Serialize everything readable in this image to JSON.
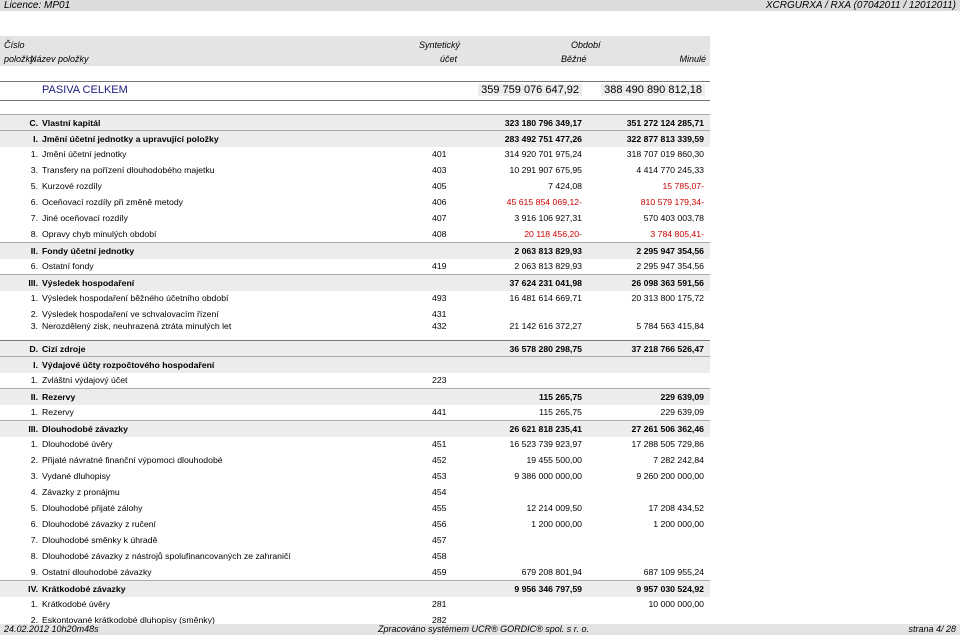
{
  "top": {
    "left": "Licence: MP01",
    "right": "XCRGURXA / RXA  (07042011 / 12012011)"
  },
  "header": {
    "cislo": "Číslo",
    "polozky": "položky",
    "nazev": "Název položky",
    "synteticky": "Syntetický",
    "ucet": "účet",
    "obdobi": "Období",
    "bezne": "Běžné",
    "minule": "Minulé"
  },
  "pasiva": {
    "label": "PASIVA CELKEM",
    "bezne": "359 759 076 647,92",
    "minule": "388 490 890 812,18"
  },
  "rows": [
    {
      "c": "C.",
      "n": "Vlastní kapitál",
      "a": "",
      "v1": "323 180 796 349,17",
      "v2": "351 272 124 285,71"
    },
    {
      "c": "I.",
      "n": "Jmění účetní jednotky a upravující položky",
      "a": "",
      "v1": "283 492 751 477,26",
      "v2": "322 877 813 339,59"
    },
    {
      "c": "1.",
      "n": "Jmění účetní jednotky",
      "a": "401",
      "v1": "314 920 701 975,24",
      "v2": "318 707 019 860,30"
    },
    {
      "c": "3.",
      "n": "Transfery na pořízení dlouhodobého majetku",
      "a": "403",
      "v1": "10 291 907 675,95",
      "v2": "4 414 770 245,33"
    },
    {
      "c": "5.",
      "n": "Kurzové rozdíly",
      "a": "405",
      "v1": "7 424,08",
      "v2": "15 785,07-"
    },
    {
      "c": "6.",
      "n": "Oceňovací rozdíly při změně metody",
      "a": "406",
      "v1": "45 615 854 069,12-",
      "v2": "810 579 179,34-"
    },
    {
      "c": "7.",
      "n": "Jiné oceňovací rozdíly",
      "a": "407",
      "v1": "3 916 106 927,31",
      "v2": "570 403 003,78"
    },
    {
      "c": "8.",
      "n": "Opravy chyb minulých období",
      "a": "408",
      "v1": "20 118 456,20-",
      "v2": "3 784 805,41-"
    },
    {
      "c": "II.",
      "n": "Fondy účetní jednotky",
      "a": "",
      "v1": "2 063 813 829,93",
      "v2": "2 295 947 354,56"
    },
    {
      "c": "6.",
      "n": "Ostatní fondy",
      "a": "419",
      "v1": "2 063 813 829,93",
      "v2": "2 295 947 354,56"
    },
    {
      "c": "III.",
      "n": "Výsledek hospodaření",
      "a": "",
      "v1": "37 624 231 041,98",
      "v2": "26 098 363 591,56"
    },
    {
      "c": "1.",
      "n": "Výsledek hospodaření běžného účetního období",
      "a": "493",
      "v1": "16 481 614 669,71",
      "v2": "20 313 800 175,72"
    },
    {
      "c": "2.",
      "n": "Výsledek hospodaření ve schvalovacím řízení",
      "a": "431",
      "v1": "",
      "v2": ""
    },
    {
      "c": "3.",
      "n": "Nerozdělený zisk, neuhrazená ztráta minulých let",
      "a": "432",
      "v1": "21 142 616 372,27",
      "v2": "5 784 563 415,84"
    },
    {
      "c": "D.",
      "n": "Cizí zdroje",
      "a": "",
      "v1": "36 578 280 298,75",
      "v2": "37 218 766 526,47"
    },
    {
      "c": "I.",
      "n": "Výdajové účty rozpočtového hospodaření",
      "a": "",
      "v1": "",
      "v2": ""
    },
    {
      "c": "1.",
      "n": "Zvláštní výdajový účet",
      "a": "223",
      "v1": "",
      "v2": ""
    },
    {
      "c": "II.",
      "n": "Rezervy",
      "a": "",
      "v1": "115 265,75",
      "v2": "229 639,09"
    },
    {
      "c": "1.",
      "n": "Rezervy",
      "a": "441",
      "v1": "115 265,75",
      "v2": "229 639,09"
    },
    {
      "c": "III.",
      "n": "Dlouhodobé závazky",
      "a": "",
      "v1": "26 621 818 235,41",
      "v2": "27 261 506 362,46"
    },
    {
      "c": "1.",
      "n": "Dlouhodobé úvěry",
      "a": "451",
      "v1": "16 523 739 923,97",
      "v2": "17 288 505 729,86"
    },
    {
      "c": "2.",
      "n": "Přijaté návratné finanční výpomoci dlouhodobé",
      "a": "452",
      "v1": "19 455 500,00",
      "v2": "7 282 242,84"
    },
    {
      "c": "3.",
      "n": "Vydané dluhopisy",
      "a": "453",
      "v1": "9 386 000 000,00",
      "v2": "9 260 200 000,00"
    },
    {
      "c": "4.",
      "n": "Závazky z pronájmu",
      "a": "454",
      "v1": "",
      "v2": ""
    },
    {
      "c": "5.",
      "n": "Dlouhodobé přijaté zálohy",
      "a": "455",
      "v1": "12 214 009,50",
      "v2": "17 208 434,52"
    },
    {
      "c": "6.",
      "n": "Dlouhodobé závazky z ručení",
      "a": "456",
      "v1": "1 200 000,00",
      "v2": "1 200 000,00"
    },
    {
      "c": "7.",
      "n": "Dlouhodobé směnky k úhradě",
      "a": "457",
      "v1": "",
      "v2": ""
    },
    {
      "c": "8.",
      "n": "Dlouhodobé závazky z nástrojů spolufinancovaných ze zahraničí",
      "a": "458",
      "v1": "",
      "v2": ""
    },
    {
      "c": "9.",
      "n": "Ostatní dlouhodobé závazky",
      "a": "459",
      "v1": "679 208 801,94",
      "v2": "687 109 955,24"
    },
    {
      "c": "IV.",
      "n": "Krátkodobé závazky",
      "a": "",
      "v1": "9 956 346 797,59",
      "v2": "9 957 030 524,92"
    },
    {
      "c": "1.",
      "n": "Krátkodobé úvěry",
      "a": "281",
      "v1": "",
      "v2": "10 000 000,00"
    },
    {
      "c": "2.",
      "n": "Eskontované krátkodobé dluhopisy (směnky)",
      "a": "282",
      "v1": "",
      "v2": ""
    }
  ],
  "footer": {
    "left": "24.02.2012 10h20m48s",
    "center": "Zpracováno systémem UCR® GORDIC® spol. s r. o.",
    "right": "strana 4/ 28"
  }
}
